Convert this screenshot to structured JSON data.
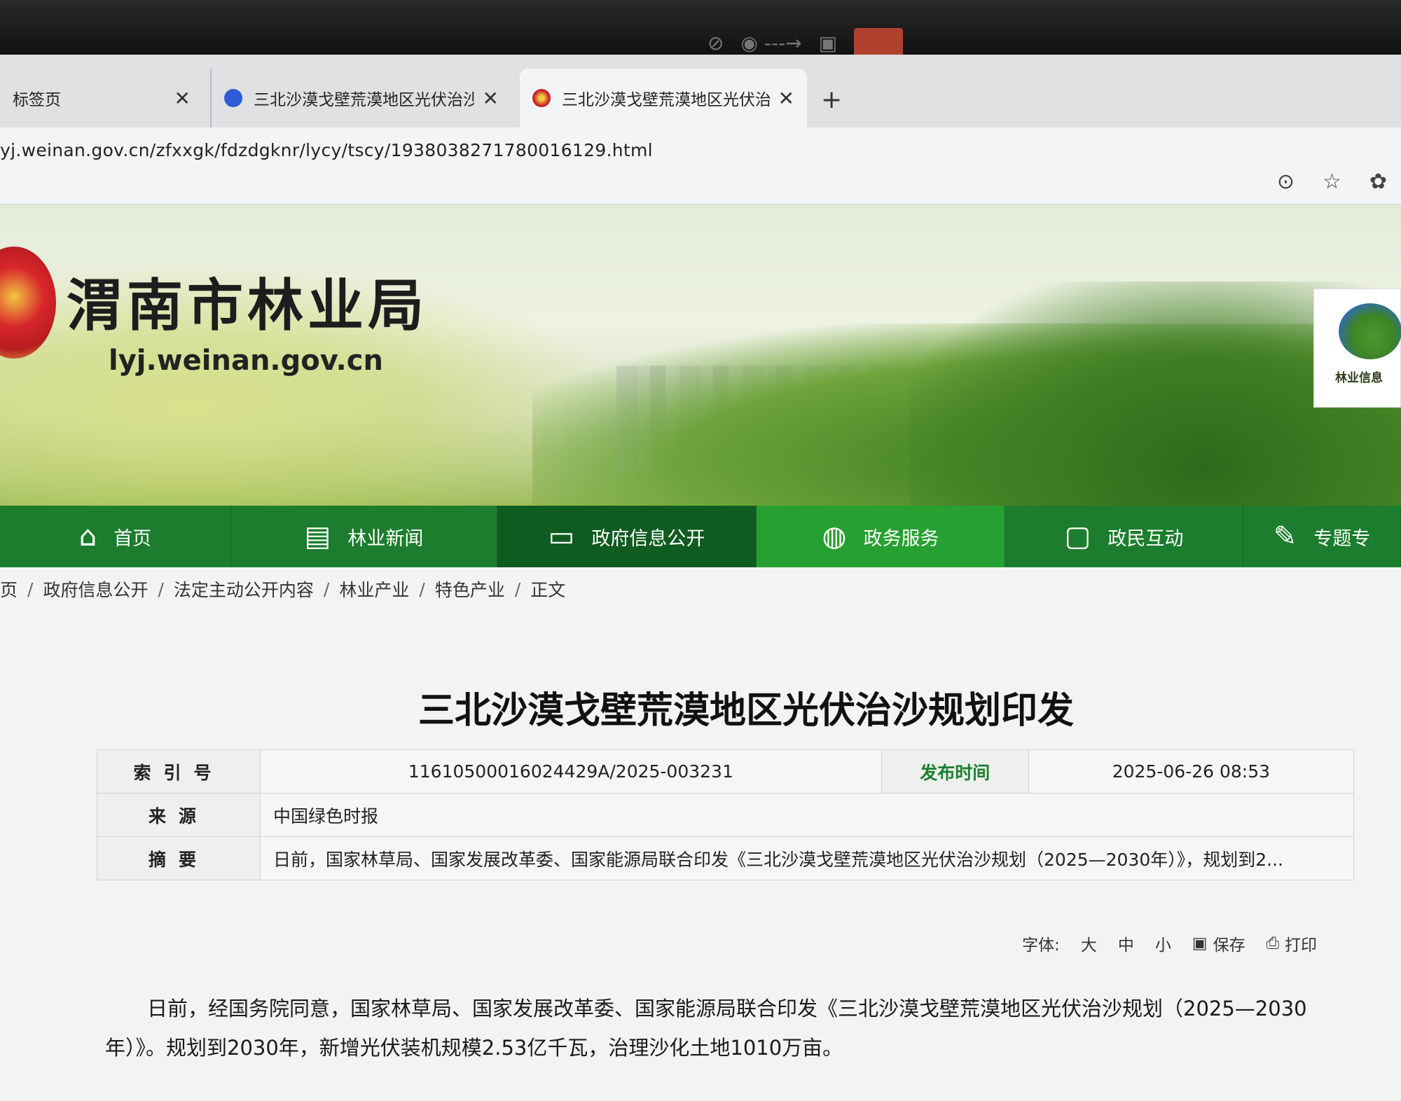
{
  "browser": {
    "tabs": [
      {
        "title": "标签页",
        "close": "✕"
      },
      {
        "title": "三北沙漠戈壁荒漠地区光伏治沙规",
        "close": "✕"
      },
      {
        "title": "三北沙漠戈壁荒漠地区光伏治沙规",
        "close": "✕"
      }
    ],
    "new_tab": "+",
    "url": "yj.weinan.gov.cn/zfxxgk/fdzdgknr/lycy/tscy/1938038271780016129.html",
    "icons": [
      "more-icon",
      "star-icon",
      "extensions-icon"
    ]
  },
  "site": {
    "title": "渭南市林业局",
    "domain": "lyj.weinan.gov.cn",
    "side_logo_text": "林业信息"
  },
  "nav": [
    {
      "label": "首页",
      "icon": "⌂"
    },
    {
      "label": "林业新闻",
      "icon": "▤"
    },
    {
      "label": "政府信息公开",
      "icon": "▭"
    },
    {
      "label": "政务服务",
      "icon": "◍"
    },
    {
      "label": "政民互动",
      "icon": "▢"
    },
    {
      "label": "专题专",
      "icon": "✎"
    }
  ],
  "breadcrumb": [
    "页",
    "政府信息公开",
    "法定主动公开内容",
    "林业产业",
    "特色产业",
    "正文"
  ],
  "breadcrumb_sep": "/",
  "article": {
    "title": "三北沙漠戈壁荒漠地区光伏治沙规划印发",
    "meta": {
      "index_label": "索引号",
      "index_value": "11610500016024429A/2025-003231",
      "date_label": "发布时间",
      "date_value": "2025-06-26 08:53",
      "source_label": "来源",
      "source_value": "中国绿色时报",
      "summary_label": "摘要",
      "summary_value": "日前，国家林草局、国家发展改革委、国家能源局联合印发《三北沙漠戈壁荒漠地区光伏治沙规划（2025—2030年）》，规划到2..."
    },
    "toolbar": {
      "font_label": "字体:",
      "font_large": "大",
      "font_medium": "中",
      "font_small": "小",
      "save": "保存",
      "print": "打印"
    },
    "body": [
      "日前，经国务院同意，国家林草局、国家发展改革委、国家能源局联合印发《三北沙漠戈壁荒漠地区光伏治沙规划（2025—2030年）》。规划到2030年，新增光伏装机规模2.53亿千瓦，治理沙化土地1010万亩。"
    ]
  }
}
